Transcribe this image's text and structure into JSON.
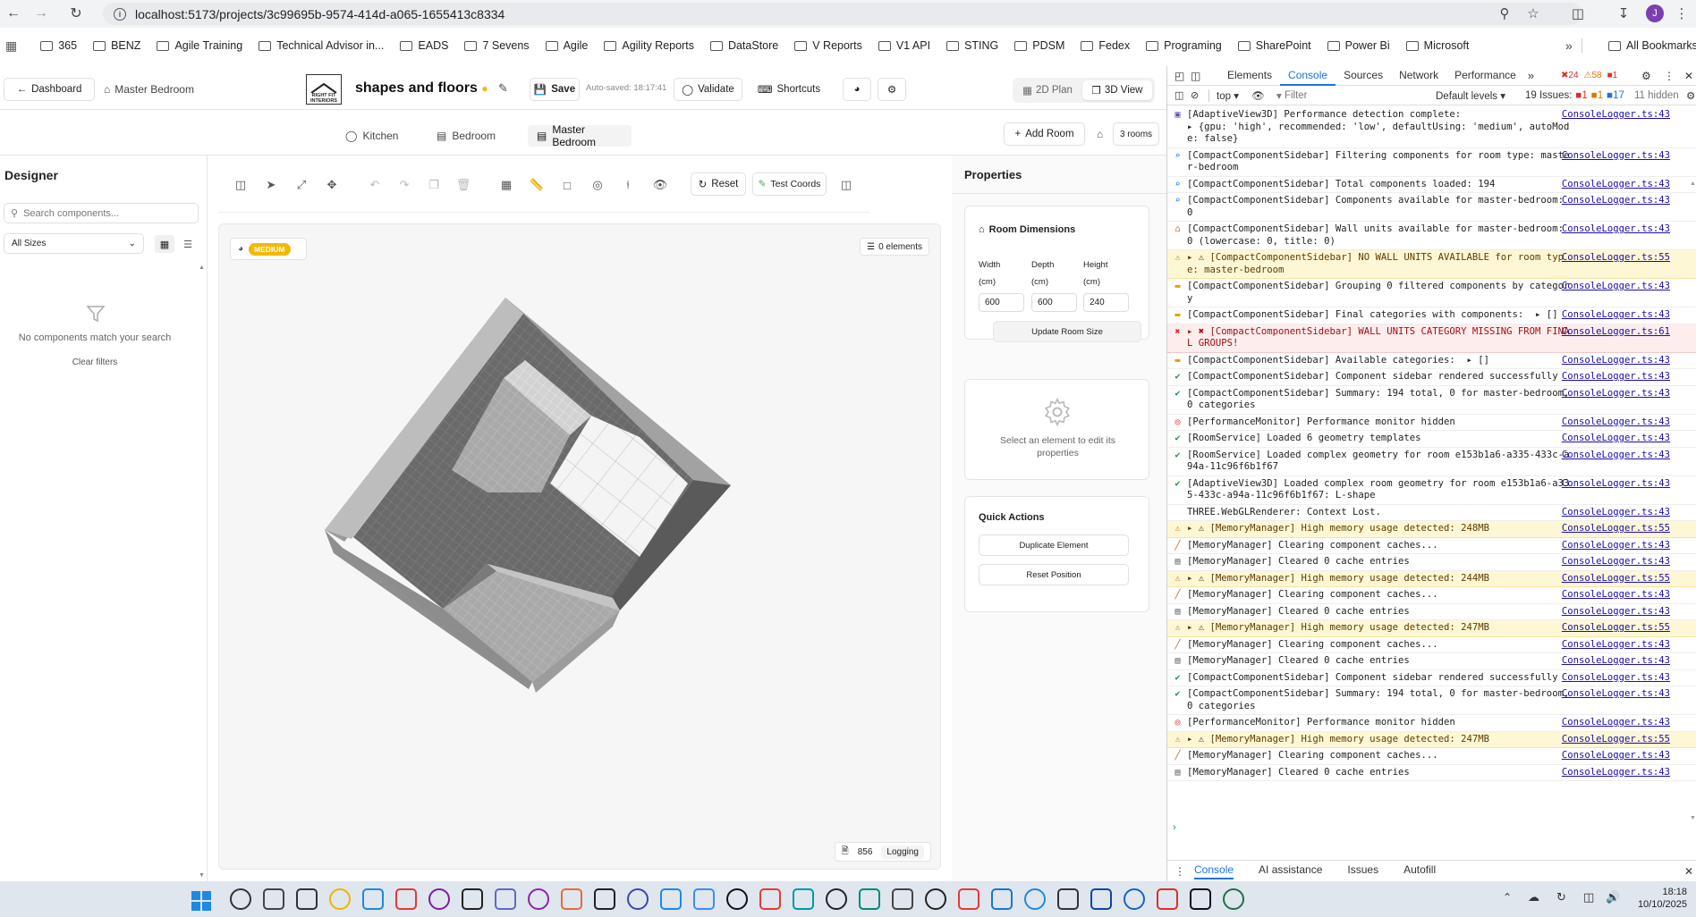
{
  "browser": {
    "url": "localhost:5173/projects/3c99695b-9574-414d-a065-1655413c8334",
    "bookmarks": [
      "365",
      "BENZ",
      "Agile Training",
      "Technical Advisor in...",
      "EADS",
      "7 Sevens",
      "Agile",
      "Agility Reports",
      "DataStore",
      "V Reports",
      "V1 API",
      "STING",
      "PDSM",
      "Fedex",
      "Programing",
      "SharePoint",
      "Power Bi",
      "Microsoft"
    ],
    "all_bookmarks": "All Bookmarks",
    "profile_initial": "J"
  },
  "app": {
    "dashboard_label": "Dashboard",
    "room_label": "Master Bedroom",
    "logo_text": "RIGHT FIT INTERIORS",
    "project_title": "shapes and floors",
    "save_label": "Save",
    "autosave": "Auto-saved: 18:17:41",
    "validate_label": "Validate",
    "shortcuts_label": "Shortcuts",
    "view_2d": "2D Plan",
    "view_3d": "3D View"
  },
  "rooms": {
    "tabs": [
      "Kitchen",
      "Bedroom",
      "Master Bedroom"
    ],
    "add_room": "Add Room",
    "count": "3 rooms"
  },
  "designer": {
    "title": "Designer",
    "search_placeholder": "Search components...",
    "size_filter": "All Sizes",
    "empty_message": "No components match your search",
    "clear_filters": "Clear filters"
  },
  "toolbar": {
    "reset": "Reset",
    "test_coords": "Test Coords"
  },
  "canvas": {
    "quality_badge": "MEDIUM",
    "elements_count": "0 elements",
    "footer_count": "856",
    "footer_logging": "Logging"
  },
  "properties": {
    "title": "Properties",
    "room_dimensions": "Room Dimensions",
    "width_label": "Width",
    "depth_label": "Depth",
    "height_label": "Height",
    "unit": "(cm)",
    "width": "600",
    "depth": "600",
    "height": "240",
    "update_button": "Update Room Size",
    "select_message": "Select an element to edit its properties",
    "quick_actions": "Quick Actions",
    "duplicate": "Duplicate Element",
    "reset_position": "Reset Position"
  },
  "devtools": {
    "tabs": [
      "Elements",
      "Console",
      "Sources",
      "Network",
      "Performance"
    ],
    "active_tab": "Console",
    "err_count": "24",
    "warn_count": "58",
    "info_count": "1",
    "context": "top",
    "filter_placeholder": "Filter",
    "levels": "Default levels",
    "issues_label": "19 Issues:",
    "issues_err": "1",
    "issues_warn": "1",
    "issues_info": "17",
    "hidden": "11 hidden",
    "bottom_tabs": [
      "Console",
      "AI assistance",
      "Issues",
      "Autofill"
    ],
    "logs": [
      {
        "type": "info",
        "icon": "gamepad",
        "text": "[AdaptiveView3D] Performance detection complete:\n▸ {gpu: 'high', recommended: 'low', defaultUsing: 'medium', autoMode: false}",
        "src": "ConsoleLogger.ts:43"
      },
      {
        "type": "info",
        "icon": "search",
        "text": "[CompactComponentSidebar] Filtering components for room type: master-bedroom",
        "src": "ConsoleLogger.ts:43"
      },
      {
        "type": "info",
        "icon": "search",
        "text": "[CompactComponentSidebar] Total components loaded: 194",
        "src": "ConsoleLogger.ts:43"
      },
      {
        "type": "info",
        "icon": "search",
        "text": "[CompactComponentSidebar] Components available for master-bedroom: 0",
        "src": "ConsoleLogger.ts:43"
      },
      {
        "type": "info",
        "icon": "house",
        "text": "[CompactComponentSidebar] Wall units available for master-bedroom: 0 (lowercase: 0, title: 0)",
        "src": "ConsoleLogger.ts:43"
      },
      {
        "type": "warn",
        "icon": "warn",
        "text": "▸ ⚠ [CompactComponentSidebar] NO WALL UNITS AVAILABLE for room type: master-bedroom",
        "src": "ConsoleLogger.ts:55"
      },
      {
        "type": "info",
        "icon": "folder",
        "text": "[CompactComponentSidebar] Grouping 0 filtered components by category",
        "src": "ConsoleLogger.ts:43"
      },
      {
        "type": "info",
        "icon": "folder",
        "text": "[CompactComponentSidebar] Final categories with components:  ▸ []",
        "src": "ConsoleLogger.ts:43"
      },
      {
        "type": "err",
        "icon": "err",
        "text": "▸ ✖ [CompactComponentSidebar] WALL UNITS CATEGORY MISSING FROM FINAL GROUPS!",
        "src": "ConsoleLogger.ts:61"
      },
      {
        "type": "info",
        "icon": "folder",
        "text": "[CompactComponentSidebar] Available categories:  ▸ []",
        "src": "ConsoleLogger.ts:43"
      },
      {
        "type": "info",
        "icon": "check",
        "text": "[CompactComponentSidebar] Component sidebar rendered successfully",
        "src": "ConsoleLogger.ts:43"
      },
      {
        "type": "info",
        "icon": "check",
        "text": "[CompactComponentSidebar] Summary: 194 total, 0 for master-bedroom, 0 categories",
        "src": "ConsoleLogger.ts:43"
      },
      {
        "type": "info",
        "icon": "target",
        "text": "[PerformanceMonitor] Performance monitor hidden",
        "src": "ConsoleLogger.ts:43"
      },
      {
        "type": "info",
        "icon": "check",
        "text": "[RoomService] Loaded 6 geometry templates",
        "src": "ConsoleLogger.ts:43"
      },
      {
        "type": "info",
        "icon": "check",
        "text": "[RoomService] Loaded complex geometry for room e153b1a6-a335-433c-a94a-11c96f6b1f67",
        "src": "ConsoleLogger.ts:43"
      },
      {
        "type": "info",
        "icon": "check",
        "text": "[AdaptiveView3D] Loaded complex room geometry for room e153b1a6-a335-433c-a94a-11c96f6b1f67: L-shape",
        "src": "ConsoleLogger.ts:43"
      },
      {
        "type": "info",
        "icon": "none",
        "text": "THREE.WebGLRenderer: Context Lost.",
        "src": "ConsoleLogger.ts:43"
      },
      {
        "type": "warn",
        "icon": "warn",
        "text": "▸ ⚠ [MemoryManager] High memory usage detected: 248MB",
        "src": "ConsoleLogger.ts:55"
      },
      {
        "type": "info",
        "icon": "broom",
        "text": "[MemoryManager] Clearing component caches...",
        "src": "ConsoleLogger.ts:43"
      },
      {
        "type": "info",
        "icon": "trash",
        "text": "[MemoryManager] Cleared 0 cache entries",
        "src": "ConsoleLogger.ts:43"
      },
      {
        "type": "warn",
        "icon": "warn",
        "text": "▸ ⚠ [MemoryManager] High memory usage detected: 244MB",
        "src": "ConsoleLogger.ts:55"
      },
      {
        "type": "info",
        "icon": "broom",
        "text": "[MemoryManager] Clearing component caches...",
        "src": "ConsoleLogger.ts:43"
      },
      {
        "type": "info",
        "icon": "trash",
        "text": "[MemoryManager] Cleared 0 cache entries",
        "src": "ConsoleLogger.ts:43"
      },
      {
        "type": "warn",
        "icon": "warn",
        "text": "▸ ⚠ [MemoryManager] High memory usage detected: 247MB",
        "src": "ConsoleLogger.ts:55"
      },
      {
        "type": "info",
        "icon": "broom",
        "text": "[MemoryManager] Clearing component caches...",
        "src": "ConsoleLogger.ts:43"
      },
      {
        "type": "info",
        "icon": "trash",
        "text": "[MemoryManager] Cleared 0 cache entries",
        "src": "ConsoleLogger.ts:43"
      },
      {
        "type": "info",
        "icon": "check",
        "text": "[CompactComponentSidebar] Component sidebar rendered successfully",
        "src": "ConsoleLogger.ts:43"
      },
      {
        "type": "info",
        "icon": "check",
        "text": "[CompactComponentSidebar] Summary: 194 total, 0 for master-bedroom, 0 categories",
        "src": "ConsoleLogger.ts:43"
      },
      {
        "type": "info",
        "icon": "target",
        "text": "[PerformanceMonitor] Performance monitor hidden",
        "src": "ConsoleLogger.ts:43"
      },
      {
        "type": "warn",
        "icon": "warn",
        "text": "▸ ⚠ [MemoryManager] High memory usage detected: 247MB",
        "src": "ConsoleLogger.ts:55"
      },
      {
        "type": "info",
        "icon": "broom",
        "text": "[MemoryManager] Clearing component caches...",
        "src": "ConsoleLogger.ts:43"
      },
      {
        "type": "info",
        "icon": "trash",
        "text": "[MemoryManager] Cleared 0 cache entries",
        "src": "ConsoleLogger.ts:43"
      }
    ]
  },
  "taskbar": {
    "time": "18:18",
    "date": "10/10/2025"
  },
  "colors": {
    "accent_yellow": "#f5b800",
    "devtools_blue": "#1a73e8",
    "warn_bg": "#fef7d6",
    "err_bg": "#fdeded"
  }
}
